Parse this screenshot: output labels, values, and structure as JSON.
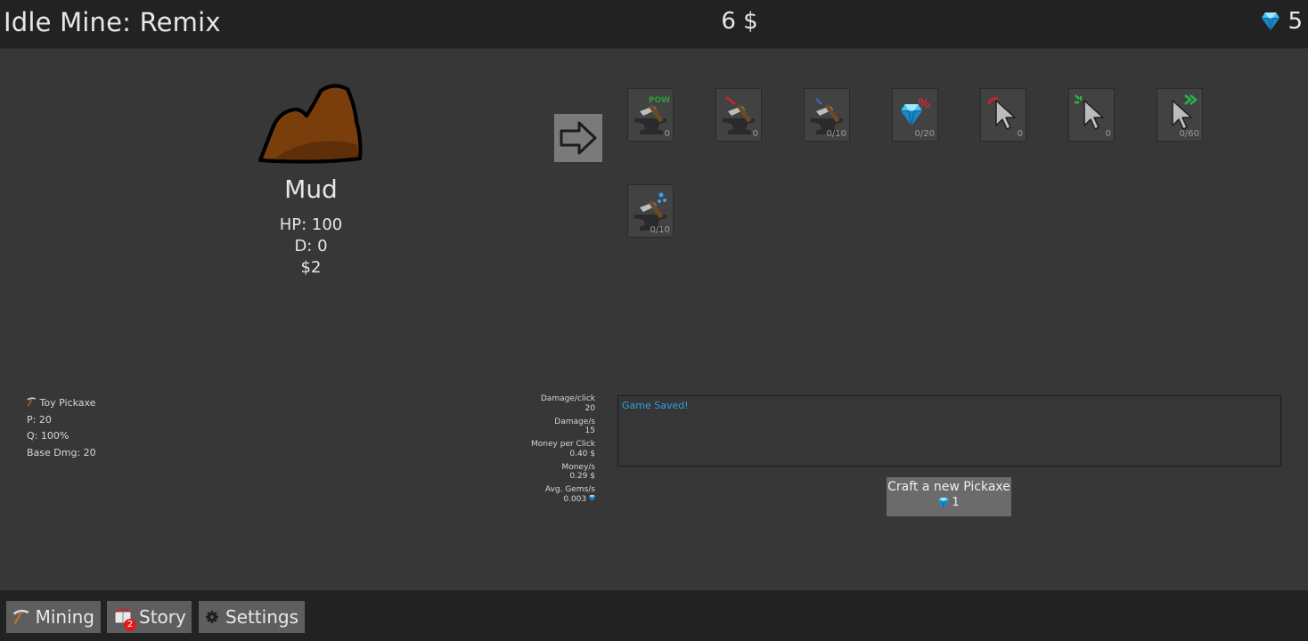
{
  "app": {
    "title": "Idle Mine: Remix",
    "money": "6 $",
    "gems": "5"
  },
  "ore": {
    "name": "Mud",
    "hp": "HP: 100",
    "defense": "D: 0",
    "value": "$2"
  },
  "upgrades": [
    {
      "name": "pow-upgrade",
      "count": "0"
    },
    {
      "name": "pickaxe-damage-upgrade",
      "count": "0"
    },
    {
      "name": "pickaxe-speed-upgrade",
      "count": "0/10"
    },
    {
      "name": "gem-chance-upgrade",
      "count": "0/20"
    },
    {
      "name": "click-power-upgrade",
      "count": "0"
    },
    {
      "name": "click-crit-upgrade",
      "count": "0"
    },
    {
      "name": "click-speed-upgrade",
      "count": "0/60"
    },
    {
      "name": "pickaxe-water-upgrade",
      "count": "0/10"
    }
  ],
  "pickaxe": {
    "name": "Toy Pickaxe",
    "power": "P: 20",
    "quality": "Q: 100%",
    "base_damage": "Base Dmg: 20"
  },
  "stats": {
    "damage_click_label": "Damage/click",
    "damage_click": "20",
    "damage_s_label": "Damage/s",
    "damage_s": "15",
    "money_click_label": "Money per Click",
    "money_click": "0.40 $",
    "money_s_label": "Money/s",
    "money_s": "0.29 $",
    "gems_s_label": "Avg. Gems/s",
    "gems_s": "0.003"
  },
  "log": {
    "message": "Game Saved!"
  },
  "craft": {
    "label": "Craft a new Pickaxe",
    "cost": "1"
  },
  "nav": {
    "mining": "Mining",
    "story": "Story",
    "story_badge": "2",
    "settings": "Settings"
  },
  "colors": {
    "accent_blue": "#2f9fe6",
    "gem": "#3cc8f0",
    "rock": "#7a3e0c",
    "badge": "#e01b1b"
  }
}
